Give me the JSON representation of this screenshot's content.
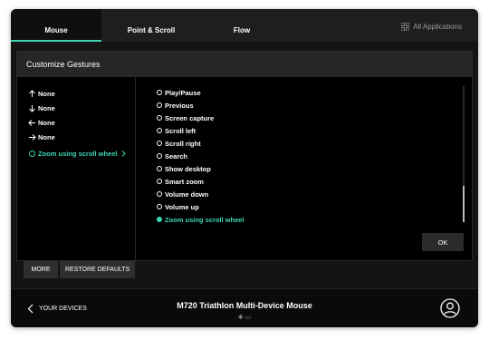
{
  "colors": {
    "accent": "#3ed6b2",
    "background": "#000000",
    "titlebar": "#1e1e1e"
  },
  "tabs": [
    {
      "label": "Mouse",
      "active": true
    },
    {
      "label": "Point & Scroll",
      "active": false
    },
    {
      "label": "Flow",
      "active": false
    }
  ],
  "all_apps": {
    "label": "All Applications",
    "icon": "grid-icon"
  },
  "panel": {
    "title": "Customize Gestures",
    "gestures": [
      {
        "direction": "up-arrow-icon",
        "label": "None"
      },
      {
        "direction": "down-arrow-icon",
        "label": "None"
      },
      {
        "direction": "left-arrow-icon",
        "label": "None"
      },
      {
        "direction": "right-arrow-icon",
        "label": "None"
      },
      {
        "direction": "radio",
        "label": "Zoom using scroll wheel"
      }
    ],
    "options": [
      {
        "label": "Play/Pause",
        "selected": false
      },
      {
        "label": "Previous",
        "selected": false
      },
      {
        "label": "Screen capture",
        "selected": false
      },
      {
        "label": "Scroll left",
        "selected": false
      },
      {
        "label": "Scroll right",
        "selected": false
      },
      {
        "label": "Search",
        "selected": false
      },
      {
        "label": "Show desktop",
        "selected": false
      },
      {
        "label": "Smart zoom",
        "selected": false
      },
      {
        "label": "Volume down",
        "selected": false
      },
      {
        "label": "Volume up",
        "selected": false
      },
      {
        "label": "Zoom using scroll wheel",
        "selected": true
      }
    ],
    "ok_label": "OK"
  },
  "buttons": {
    "more": "MORE",
    "restore": "RESTORE DEFAULTS"
  },
  "footer": {
    "back_label": "YOUR DEVICES",
    "device_name": "M720 Triathlon Multi-Device Mouse",
    "status": "✱ ▭"
  }
}
